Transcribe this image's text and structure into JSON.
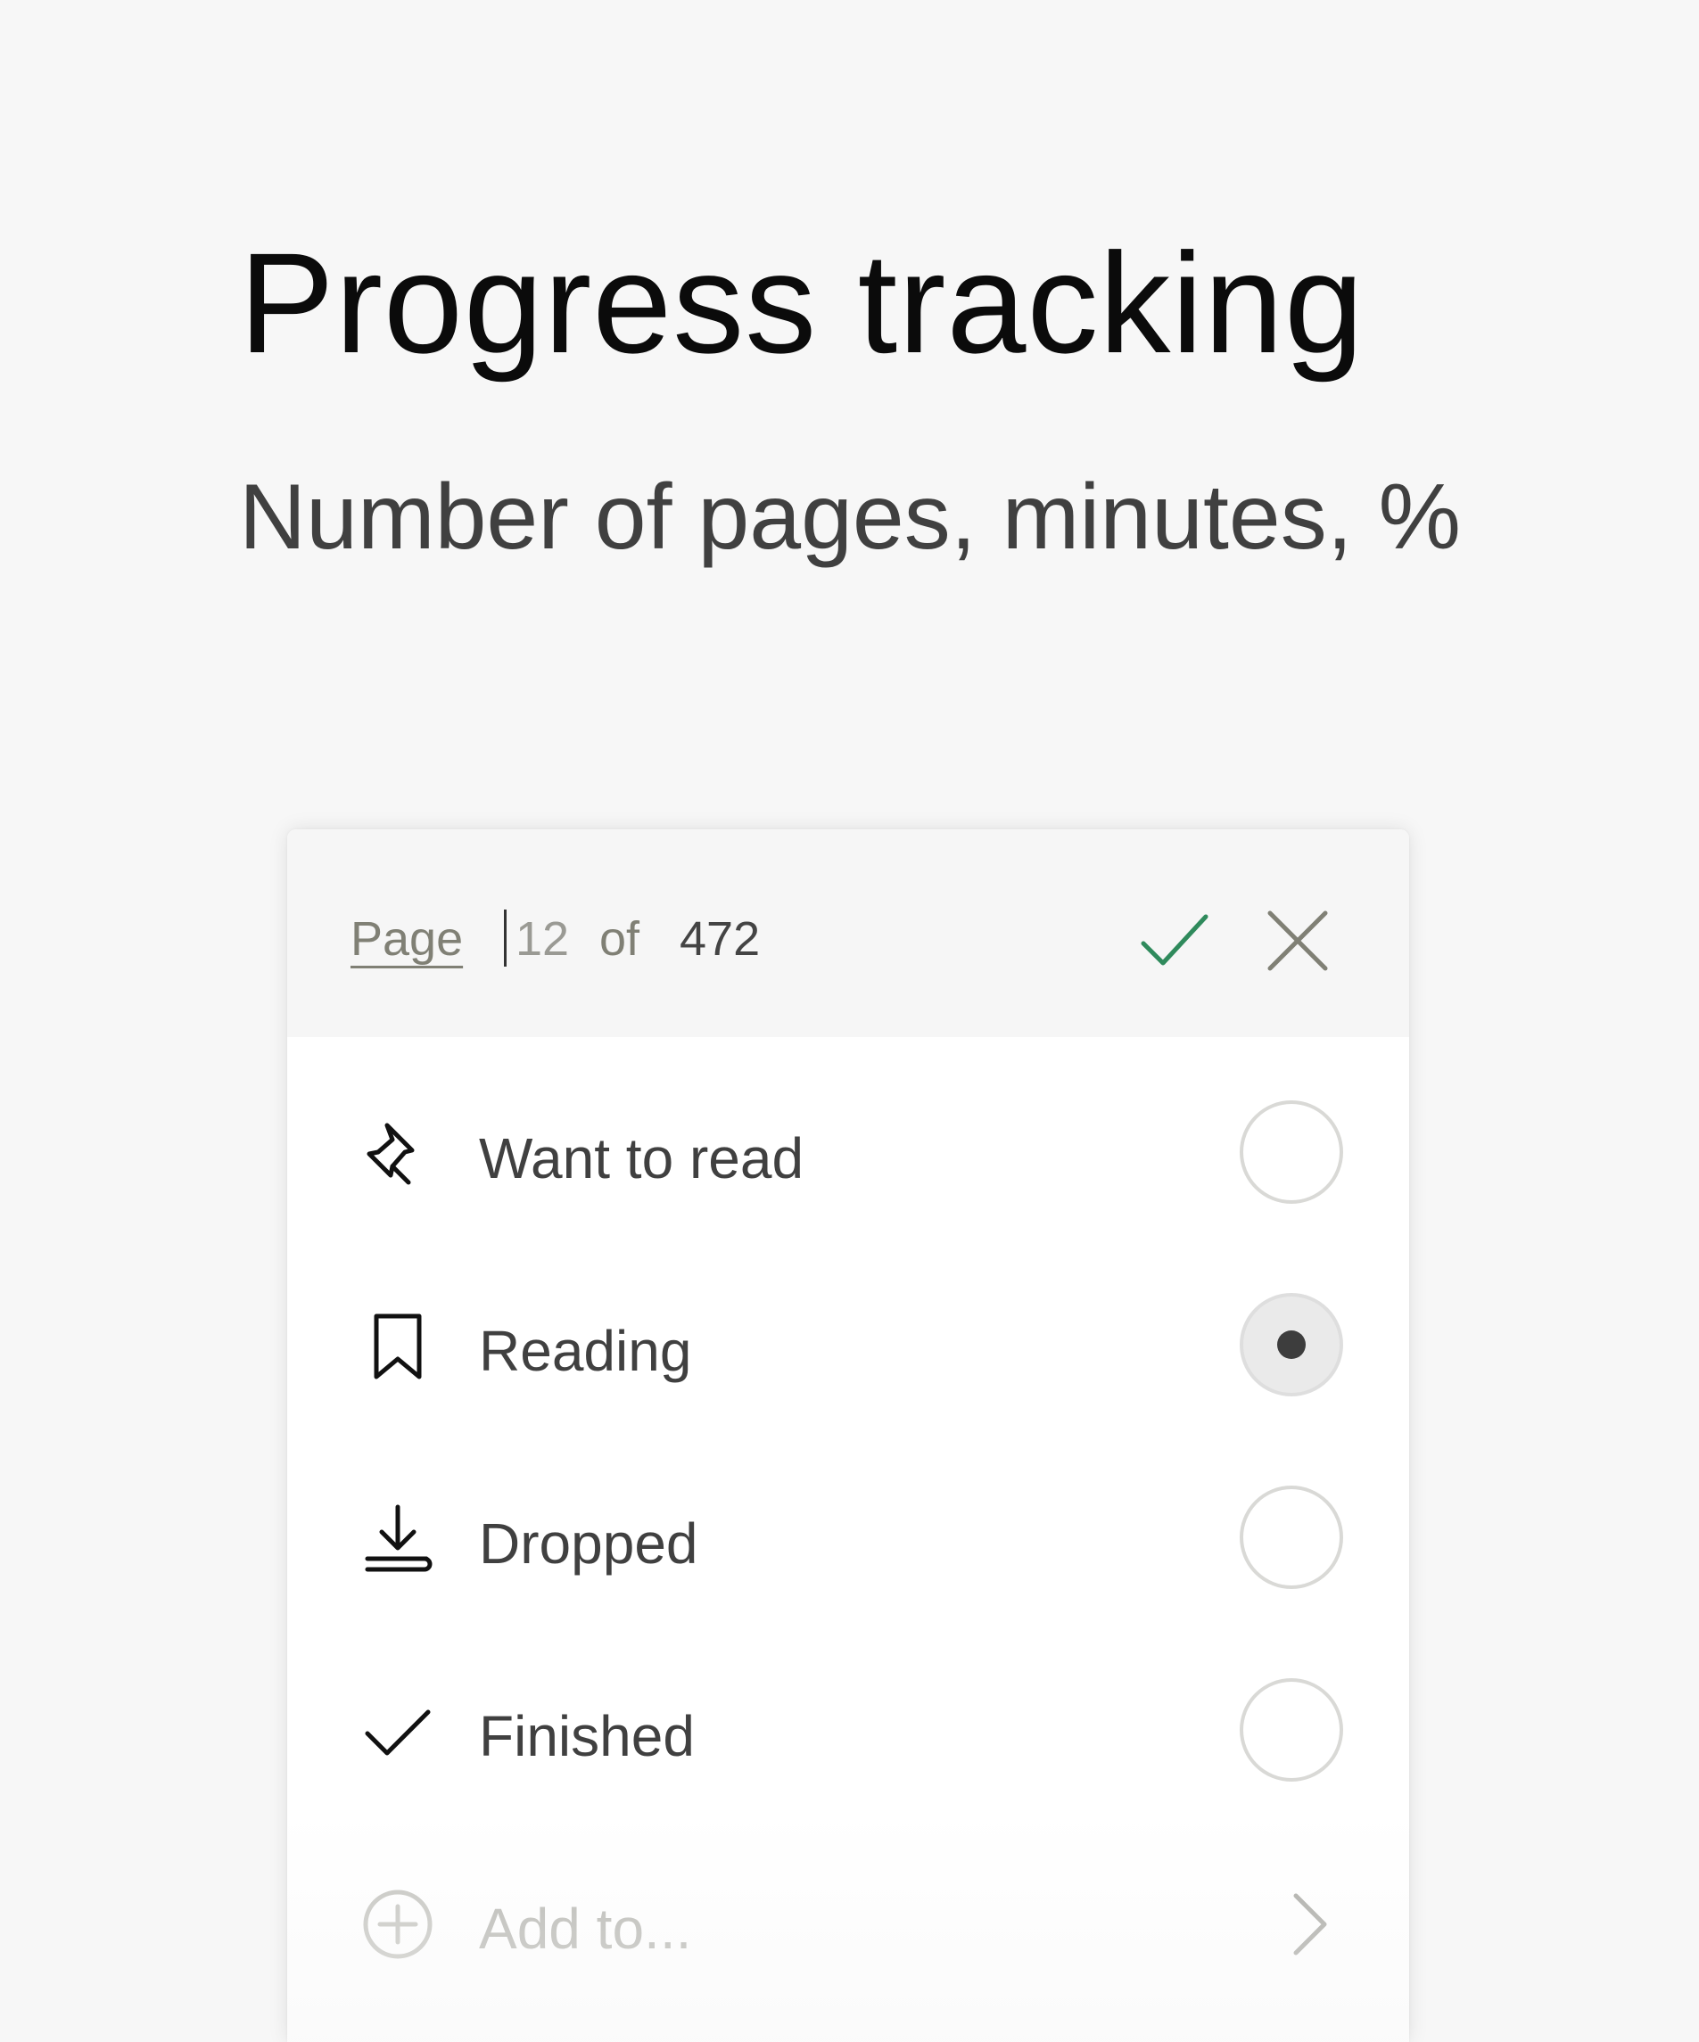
{
  "hero": {
    "title": "Progress tracking",
    "subtitle": "Number of pages, minutes, %"
  },
  "progress": {
    "unit_label": "Page",
    "current_value": "12",
    "of_label": "of",
    "total": "472",
    "confirm_icon": "checkmark-icon",
    "cancel_icon": "close-icon",
    "accent_color": "#2f8a5c"
  },
  "statuses": {
    "want_to_read": {
      "label": "Want to read",
      "icon": "pushpin-icon",
      "selected": false
    },
    "reading": {
      "label": "Reading",
      "icon": "bookmark-icon",
      "selected": true
    },
    "dropped": {
      "label": "Dropped",
      "icon": "download-tray-icon",
      "selected": false
    },
    "finished": {
      "label": "Finished",
      "icon": "checkmark-icon",
      "selected": false
    }
  },
  "add_to": {
    "label": "Add to...",
    "icon": "plus-circle-icon",
    "chevron_icon": "chevron-right-icon"
  }
}
